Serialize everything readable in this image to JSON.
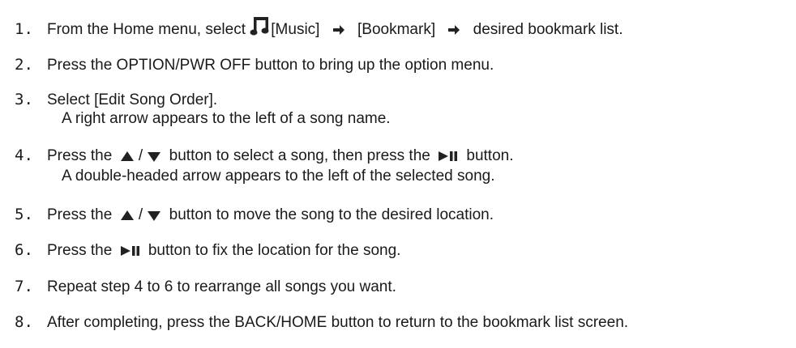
{
  "steps": [
    {
      "num": "1.",
      "a": "From the Home menu, select",
      "music": "[Music]",
      "bookmark": "[Bookmark]",
      "list": "desired bookmark list."
    },
    {
      "num": "2.",
      "text": "Press the OPTION/PWR OFF button to bring up the option menu."
    },
    {
      "num": "3.",
      "text": "Select [Edit Song Order].",
      "sub": "A right arrow appears to the left of a song name."
    },
    {
      "num": "4.",
      "a": "Press the",
      "slash": "/",
      "b": "button to select a song, then press the",
      "c": "button.",
      "sub": "A double-headed arrow appears to the left of the selected song."
    },
    {
      "num": "5.",
      "a": "Press the",
      "slash": "/",
      "b": "button to move the song to the desired location."
    },
    {
      "num": "6.",
      "a": "Press the",
      "b": "button to fix the location for the song."
    },
    {
      "num": "7.",
      "text": "Repeat step 4 to 6 to rearrange all songs you want."
    },
    {
      "num": "8.",
      "text": "After completing, press the BACK/HOME button to return to the bookmark list screen."
    }
  ],
  "icons": {
    "music": "music-note-icon",
    "right_arrow": "right-arrow-icon",
    "up": "up-triangle-icon",
    "down": "down-triangle-icon",
    "play_pause": "play-pause-icon"
  },
  "colors": {
    "text": "#1a1a1a",
    "icon": "#222222"
  }
}
